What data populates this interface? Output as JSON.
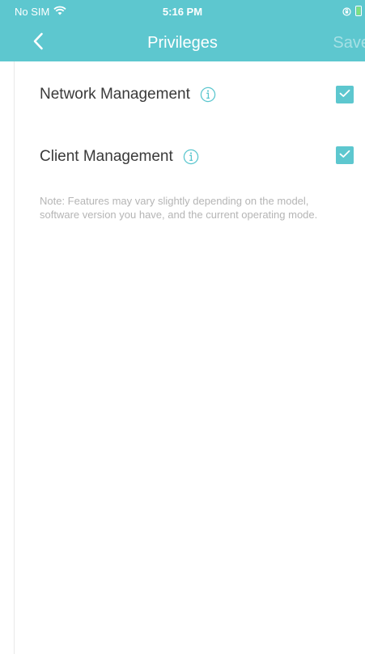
{
  "status_bar": {
    "carrier": "No SIM",
    "time": "5:16 PM"
  },
  "nav": {
    "title": "Privileges",
    "save_label": "Save"
  },
  "items": [
    {
      "label": "Network Management",
      "checked": true
    },
    {
      "label": "Client Management",
      "checked": true
    }
  ],
  "note": "Note: Features may vary slightly depending on the model, software version you have, and the current operating mode.",
  "icons": {
    "back": "chevron-left-icon",
    "info": "info-icon",
    "wifi": "wifi-icon",
    "checkbox": "check-icon"
  },
  "colors": {
    "accent": "#5dc7cf",
    "text": "#3a3a3a",
    "note": "#b5b5b5"
  }
}
